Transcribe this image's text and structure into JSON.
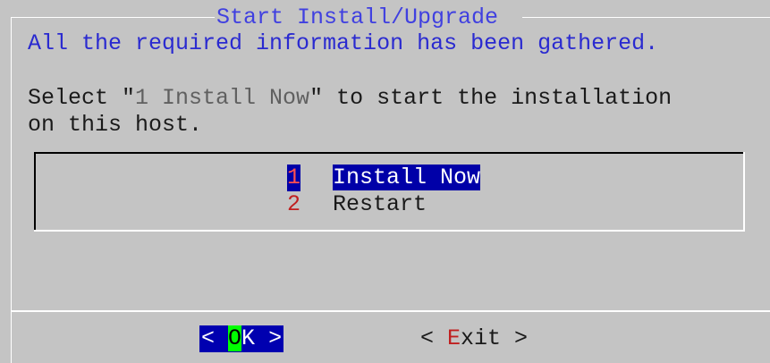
{
  "dialog": {
    "title": "Start Install/Upgrade",
    "message_line1": "All the required information has been gathered.",
    "message_line2_before": "Select \"",
    "message_line2_highlight": "1 Install Now",
    "message_line2_after": "\" to start the installation",
    "message_line3": "on this host."
  },
  "menu": {
    "items": [
      {
        "tag": "1",
        "label": "Install Now",
        "selected": true
      },
      {
        "tag": "2",
        "label": "Restart",
        "selected": false
      }
    ]
  },
  "buttons": {
    "ok": {
      "left": "<",
      "pre": " ",
      "hotkey": "O",
      "rest": "K ",
      "right": ">",
      "focused": true
    },
    "exit": {
      "left": "< ",
      "hotkey": "E",
      "rest": "xit",
      "right": " >"
    }
  },
  "colors": {
    "background": "#c4c4c4",
    "title": "#4040e0",
    "selection": "#0000a8",
    "tag": "#c02020",
    "hotkey_focus": "#00ff00"
  }
}
